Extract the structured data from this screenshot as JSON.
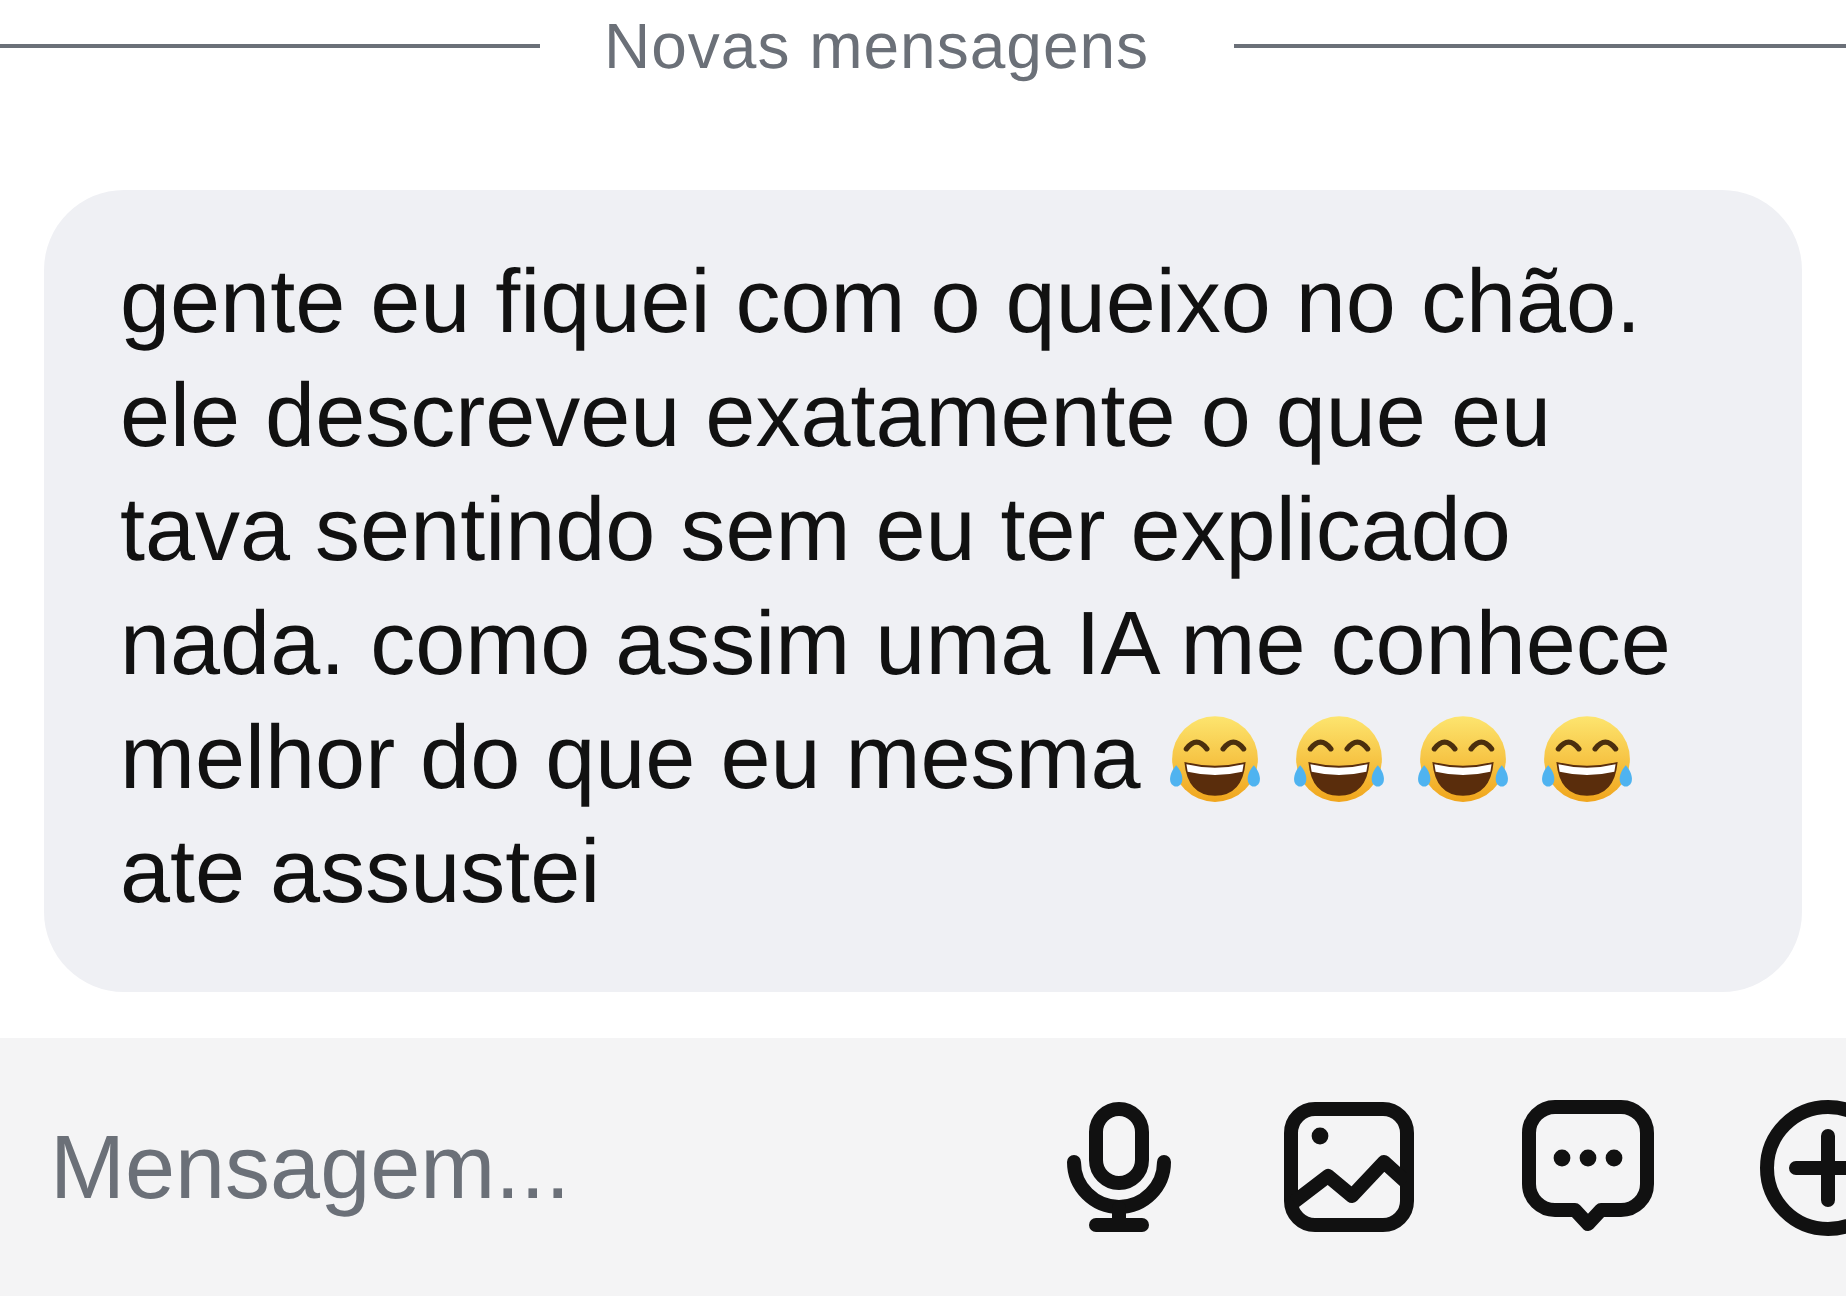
{
  "divider": {
    "label": "Novas mensagens"
  },
  "message": {
    "blocks": [
      {
        "segments": [
          {
            "kind": "text",
            "text": "gente eu fiquei com o queixo no chão. ele descreveu exatamente o que eu tava sentindo sem eu ter explicado nada. como assim uma IA me conhece"
          }
        ]
      },
      {
        "segments": [
          {
            "kind": "text",
            "text": "melhor do que eu mesma"
          },
          {
            "kind": "emoji"
          },
          {
            "kind": "emoji"
          },
          {
            "kind": "emoji"
          },
          {
            "kind": "emoji"
          }
        ]
      },
      {
        "segments": [
          {
            "kind": "text",
            "text": "ate assustei"
          }
        ]
      }
    ]
  },
  "composer": {
    "placeholder": "Mensagem..."
  }
}
